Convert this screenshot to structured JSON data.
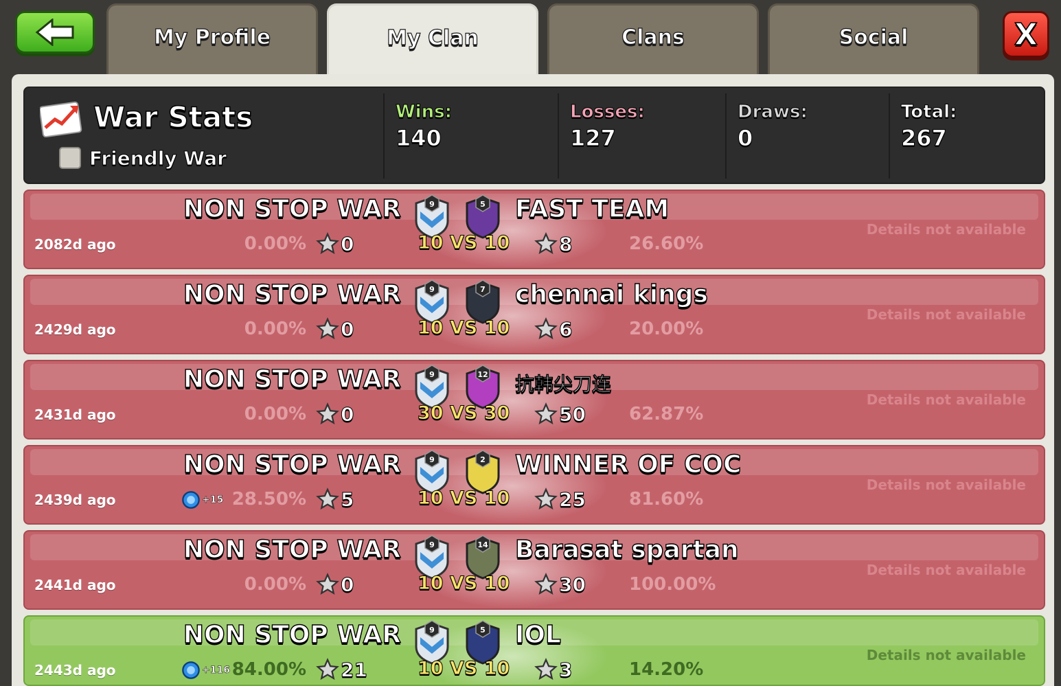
{
  "tabs": [
    {
      "label": "My Profile",
      "active": false
    },
    {
      "label": "My Clan",
      "active": true
    },
    {
      "label": "Clans",
      "active": false
    },
    {
      "label": "Social",
      "active": false
    }
  ],
  "close_label": "X",
  "war_stats": {
    "title": "War Stats",
    "friendly_war_label": "Friendly War",
    "friendly_war_checked": false,
    "wins_label": "Wins:",
    "wins": "140",
    "losses_label": "Losses:",
    "losses": "127",
    "draws_label": "Draws:",
    "draws": "0",
    "total_label": "Total:",
    "total": "267",
    "colors": {
      "wins": "#b3f07a",
      "losses": "#f3a4b5",
      "draws": "#d9d9d9",
      "total": "#ffffff"
    }
  },
  "wars": [
    {
      "ago": "2082d ago",
      "clan": "NON STOP WAR",
      "clan_level": "9",
      "opponent": "FAST TEAM",
      "opponent_level": "5",
      "our_pct": "0.00%",
      "our_stars": "0",
      "size": "10 VS 10",
      "their_stars": "8",
      "their_pct": "26.60%",
      "details": "Details not available",
      "result": "loss",
      "bonus": ""
    },
    {
      "ago": "2429d ago",
      "clan": "NON STOP WAR",
      "clan_level": "9",
      "opponent": "chennai kings",
      "opponent_level": "7",
      "our_pct": "0.00%",
      "our_stars": "0",
      "size": "10 VS 10",
      "their_stars": "6",
      "their_pct": "20.00%",
      "details": "Details not available",
      "result": "loss",
      "bonus": ""
    },
    {
      "ago": "2431d ago",
      "clan": "NON STOP WAR",
      "clan_level": "9",
      "opponent": "抗韩尖刀连",
      "opponent_level": "12",
      "our_pct": "0.00%",
      "our_stars": "0",
      "size": "30 VS 30",
      "their_stars": "50",
      "their_pct": "62.87%",
      "details": "Details not available",
      "result": "loss",
      "bonus": ""
    },
    {
      "ago": "2439d ago",
      "clan": "NON STOP WAR",
      "clan_level": "9",
      "opponent": "WINNER OF COC",
      "opponent_level": "2",
      "our_pct": "28.50%",
      "our_stars": "5",
      "size": "10 VS 10",
      "their_stars": "25",
      "their_pct": "81.60%",
      "details": "Details not available",
      "result": "loss",
      "bonus": "+15"
    },
    {
      "ago": "2441d ago",
      "clan": "NON STOP WAR",
      "clan_level": "9",
      "opponent": "Barasat spartan",
      "opponent_level": "14",
      "our_pct": "0.00%",
      "our_stars": "0",
      "size": "10 VS 10",
      "their_stars": "30",
      "their_pct": "100.00%",
      "details": "Details not available",
      "result": "loss",
      "bonus": ""
    },
    {
      "ago": "2443d ago",
      "clan": "NON STOP WAR",
      "clan_level": "9",
      "opponent": "IOL",
      "opponent_level": "5",
      "our_pct": "84.00%",
      "our_stars": "21",
      "size": "10 VS 10",
      "their_stars": "3",
      "their_pct": "14.20%",
      "details": "Details not available",
      "result": "win",
      "bonus": "+116"
    }
  ]
}
